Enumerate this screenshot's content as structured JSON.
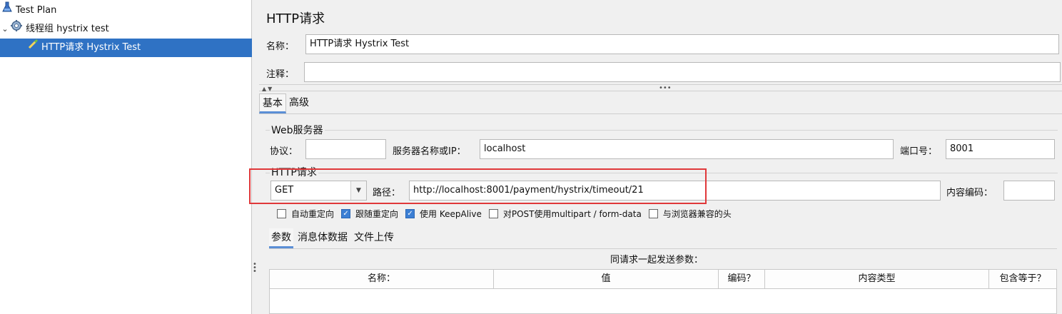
{
  "tree": {
    "items": [
      {
        "label": "Test Plan",
        "icon": "flask-icon"
      },
      {
        "label": "线程组 hystrix test",
        "icon": "gear-icon"
      },
      {
        "label": "HTTP请求 Hystrix Test",
        "icon": "pipette-icon"
      }
    ]
  },
  "panel": {
    "title": "HTTP请求",
    "name_label": "名称：",
    "name_value": "HTTP请求 Hystrix Test",
    "comment_label": "注释：",
    "comment_value": "",
    "tabs": [
      "基本",
      "高级"
    ],
    "web_server": {
      "group_title": "Web服务器",
      "protocol_label": "协议：",
      "protocol_value": "",
      "server_label": "服务器名称或IP：",
      "server_value": "localhost",
      "port_label": "端口号：",
      "port_value": "8001"
    },
    "http_request": {
      "group_title": "HTTP请求",
      "method": "GET",
      "path_label": "路径：",
      "path_value": "http://localhost:8001/payment/hystrix/timeout/21",
      "encoding_label": "内容编码：",
      "encoding_value": ""
    },
    "options": [
      {
        "label": "自动重定向",
        "checked": false
      },
      {
        "label": "跟随重定向",
        "checked": true
      },
      {
        "label": "使用 KeepAlive",
        "checked": true
      },
      {
        "label": "对POST使用multipart / form-data",
        "checked": false
      },
      {
        "label": "与浏览器兼容的头",
        "checked": false
      }
    ],
    "sub_tabs": [
      "参数",
      "消息体数据",
      "文件上传"
    ],
    "params_caption": "同请求一起发送参数：",
    "table_headers": [
      "名称：",
      "值",
      "编码？",
      "内容类型",
      "包含等于？"
    ]
  },
  "colors": {
    "selection": "#2f72c4",
    "highlight_box": "#e0383a",
    "checkbox_on": "#3c7fd4"
  }
}
